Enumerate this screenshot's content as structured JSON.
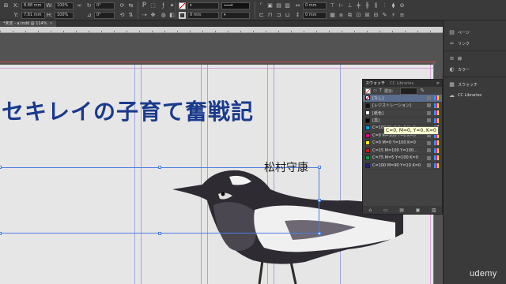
{
  "control_bar": {
    "x_label": "X:",
    "y_label": "Y:",
    "w_label": "W:",
    "h_label": "H:",
    "x_value": "8.88 mm",
    "y_value": "7.81 mm",
    "w_value": "100%",
    "h_value": "100%",
    "rotate_value": "0°",
    "shear_value": "0°",
    "stroke_value": "0 mm",
    "dim_value": "0 mm",
    "ref_letter": "P"
  },
  "doc_tab": {
    "label": "*未定 - a.indd @ 114%",
    "close": "×"
  },
  "document": {
    "title": "セキレイの子育て奮戦記",
    "author": "松村守康"
  },
  "swatches_panel": {
    "tab_active": "スウォッチ",
    "tab_inactive": "CC Libraries",
    "tint_label": "濃淡:",
    "tint_value": "%",
    "items": [
      {
        "name": "[なし]",
        "chip": "none",
        "selected": true
      },
      {
        "name": "[レジストレーション]",
        "chip": "#111111"
      },
      {
        "name": "[紙色]",
        "chip": "#ffffff"
      },
      {
        "name": "[黒]",
        "chip": "#000000"
      },
      {
        "name": "C=100 M=0 Y=0 K=0",
        "chip": "#00a0e9"
      },
      {
        "name": "C=0 M=100 Y=0 K=0",
        "chip": "#e4007f"
      },
      {
        "name": "C=0 M=0 Y=100 K=0",
        "chip": "#fff100"
      },
      {
        "name": "C=15 M=100 Y=100...",
        "chip": "#c8161d"
      },
      {
        "name": "C=75 M=5 Y=100 K=0",
        "chip": "#00a23f"
      },
      {
        "name": "C=100 M=90 Y=10 K=0",
        "chip": "#1d2088"
      }
    ],
    "tooltip": "C=0, M=0, Y=0, K=0"
  },
  "dock": {
    "items": [
      {
        "icon": "pages-icon",
        "glyph": "▤",
        "label": "ページ"
      },
      {
        "icon": "links-icon",
        "glyph": "∞",
        "label": "リンク"
      },
      {
        "icon": "stroke-icon",
        "glyph": "≡",
        "label": "線"
      },
      {
        "icon": "color-icon",
        "glyph": "◐",
        "label": "カラー"
      },
      {
        "icon": "swatches-icon",
        "glyph": "▦",
        "label": "スウォッチ"
      },
      {
        "icon": "cc-libraries-icon",
        "glyph": "☁",
        "label": "CC Libraries"
      }
    ]
  },
  "watermark": "udemy",
  "colors": {
    "title_blue": "#1a3a8c",
    "frame_blue": "#4a7ee0",
    "margin_guide": "#d9a3d9",
    "column_guide": "#9fa6dd",
    "bleed_red": "#d04a4a"
  }
}
